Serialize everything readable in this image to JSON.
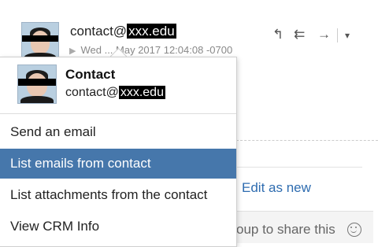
{
  "header": {
    "from_prefix": "contact@",
    "from_domain": "xxx.edu",
    "date_text": "Wed ... May 2017 12:04:08 -0700"
  },
  "toolbar": {
    "reply_icon": "↰",
    "reply_all_icon": "⇇",
    "forward_icon": "→",
    "more_icon": "▾"
  },
  "content": {
    "edit_as_new_label": "Edit as new",
    "share_placeholder": "oup to share this"
  },
  "popup": {
    "name": "Contact",
    "email_prefix": "contact@",
    "email_domain": "xxx.edu",
    "menu": [
      {
        "label": "Send an email",
        "active": false
      },
      {
        "label": "List emails from contact",
        "active": true
      },
      {
        "label": "List attachments from the contact",
        "active": false
      },
      {
        "label": "View CRM Info",
        "active": false
      }
    ]
  },
  "colors": {
    "accent": "#4677ab",
    "link": "#2e6cb0"
  }
}
